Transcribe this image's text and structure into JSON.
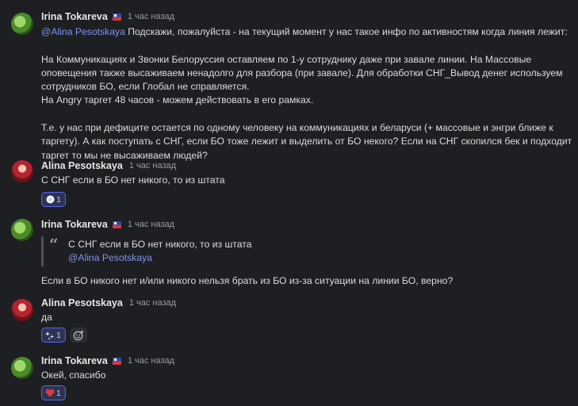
{
  "messages": [
    {
      "author": "Irina Tokareva",
      "time": "1 час назад",
      "mention": "@Alina Pesotskaya",
      "lines": [
        "Подскажи, пожалуйста - на текущий момент у нас такое инфо по активностям когда линия лежит:",
        "",
        "На Коммуникациях и Звонки Белоруссия оставляем по 1-у сотруднику даже при завале линии. На Массовые",
        "оповещения также высаживаем ненадолго для разбора (при завале). Для обработки СНГ_Вывод денег используем",
        "сотрудников БО, если Глобал не справляется.",
        "На Angry таргет 48 часов - можем действовать в его рамках.",
        "",
        "Т.е. у нас при дефиците остается по одному человеку на коммуникациях и беларуси (+ массовые и энгри ближе к",
        "таргету). А как поступать с СНГ, если БО тоже лежит и выделить от БО некого? Если на СНГ скопился бек и подходит",
        "таргет то мы не высаживаем людей?"
      ]
    },
    {
      "author": "Alina Pesotskaya",
      "time": "1 час назад",
      "text": "С СНГ если в БО нет никого, то из штата",
      "reaction": {
        "emoji": "white-circle-emoji",
        "count": "1"
      }
    },
    {
      "author": "Irina Tokareva",
      "time": "1 час назад",
      "quote_text": "С СНГ если в БО нет никого, то из штата",
      "quote_author": "@Alina Pesotskaya",
      "text": "Если в БО никого нет и/или никого нельзя брать из БО из-за ситуации на линии БО, верно?"
    },
    {
      "author": "Alina Pesotskaya",
      "time": "1 час назад",
      "text": "да",
      "reaction": {
        "emoji": "sparkles-emoji",
        "count": "1"
      }
    },
    {
      "author": "Irina Tokareva",
      "time": "1 час назад",
      "text": "Окей, спасибо",
      "reaction": {
        "emoji": "heart-emoji",
        "count": "1"
      }
    }
  ],
  "colors": {
    "background": "#1e1f22",
    "mention": "#7f95e8",
    "reaction_border": "#5865f2",
    "heart": "#e0383e"
  }
}
